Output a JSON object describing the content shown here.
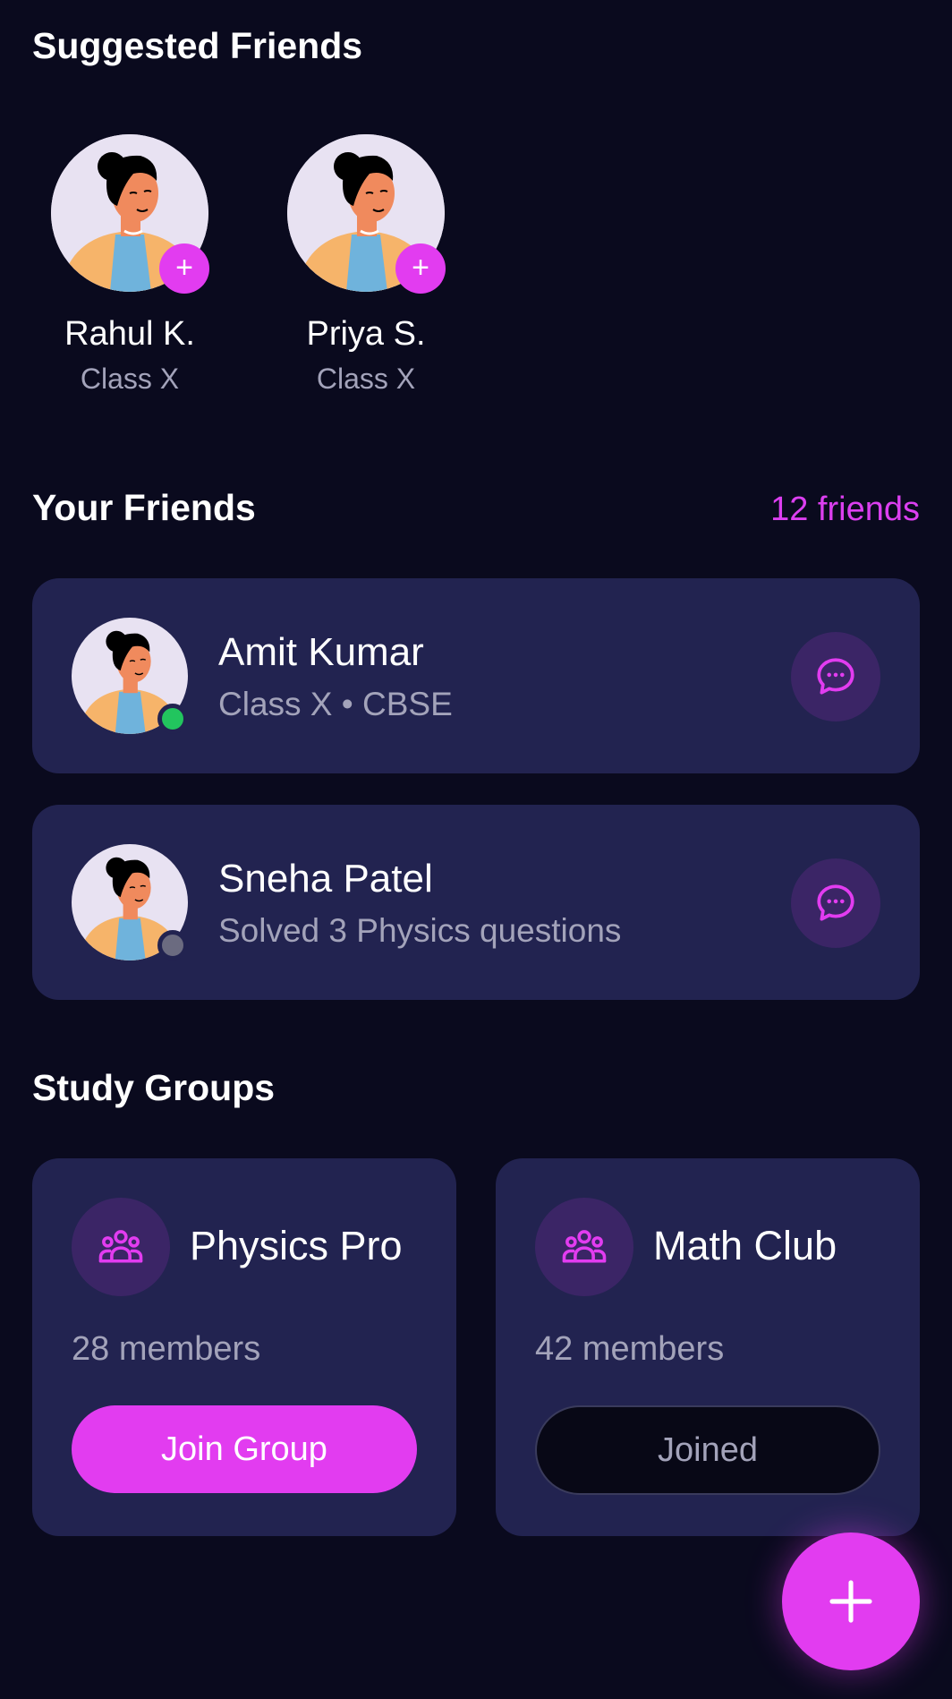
{
  "suggested": {
    "title": "Suggested Friends",
    "people": [
      {
        "name": "Rahul K.",
        "class": "Class X",
        "add_label": "+"
      },
      {
        "name": "Priya S.",
        "class": "Class X",
        "add_label": "+"
      }
    ]
  },
  "friends": {
    "title": "Your Friends",
    "count_label": "12 friends",
    "items": [
      {
        "name": "Amit Kumar",
        "subtitle": "Class X • CBSE",
        "status": "online",
        "status_color": "#22c55e",
        "icon": "chat-bubble-icon"
      },
      {
        "name": "Sneha Patel",
        "subtitle": "Solved 3 Physics questions",
        "status": "offline",
        "status_color": "#6b6b80",
        "icon": "chat-bubble-icon"
      }
    ]
  },
  "groups": {
    "title": "Study Groups",
    "items": [
      {
        "name": "Physics Pro",
        "members": "28 members",
        "action_label": "Join Group",
        "icon": "group-icon"
      },
      {
        "name": "Math Club",
        "members": "42 members",
        "action_label": "Joined",
        "icon": "group-icon"
      }
    ]
  },
  "fab": {
    "icon": "plus-icon"
  },
  "colors": {
    "background": "#0a0a1e",
    "card": "#222350",
    "accent": "#e23cf0",
    "icon_circle": "#3b2566",
    "muted_text": "#a3a3ba"
  }
}
